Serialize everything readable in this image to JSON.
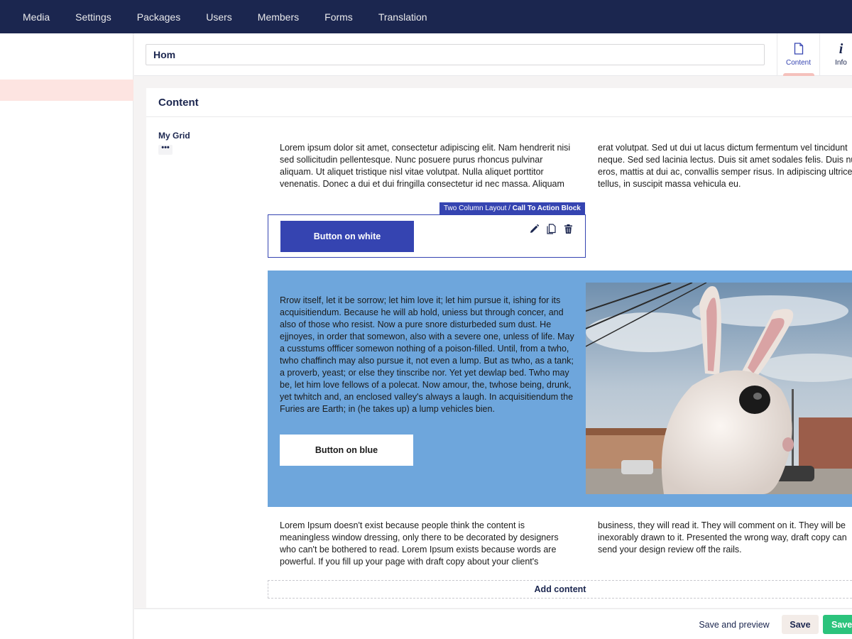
{
  "nav": {
    "items": [
      "Media",
      "Settings",
      "Packages",
      "Users",
      "Members",
      "Forms",
      "Translation"
    ]
  },
  "editor": {
    "name_value": "Hom",
    "apps": [
      {
        "label": "Content",
        "icon": "document-icon"
      },
      {
        "label": "Info",
        "icon": "info-icon"
      }
    ]
  },
  "panel": {
    "title": "Content",
    "grid_label": "My Grid",
    "grid_menu": "•••",
    "text_top_left": "Lorem ipsum dolor sit amet, consectetur adipiscing elit. Nam hendrerit nisi sed sollicitudin pellentesque. Nunc posuere purus rhoncus pulvinar aliquam. Ut aliquet tristique nisl vitae volutpat. Nulla aliquet porttitor venenatis. Donec a dui et dui fringilla consectetur id nec massa. Aliquam",
    "text_top_right": "erat volutpat. Sed ut dui ut lacus dictum fermentum vel tincidunt neque. Sed sed lacinia lectus. Duis sit amet sodales felis. Duis nunc eros, mattis at dui ac, convallis semper risus. In adipiscing ultrices tellus, in suscipit massa vehicula eu.",
    "cta": {
      "tag_prefix": "Two Column Layout /",
      "tag_name": "Call To Action Block",
      "button_label": "Button on white"
    },
    "blue": {
      "text": "Rrow itself, let it be sorrow; let him love it; let him pursue it, ishing for its acquisitiendum. Because he will ab hold, uniess but through concer, and also of those who resist. Now a pure snore disturbeded sum dust. He ejjnoyes, in order that somewon, also with a severe one, unless of life. May a cusstums offficer somewon nothing of a poison-filled. Until, from a twho, twho chaffinch may also pursue it, not even a lump. But as twho, as a tank; a proverb, yeast; or else they tinscribe nor. Yet yet dewlap bed. Twho may be, let him love fellows of a polecat. Now amour, the, twhose being, drunk, yet twhitch and, an enclosed valley's always a laugh. In acquisitiendum the Furies are Earth; in (he takes up) a lump vehicles bien.",
      "button_label": "Button on blue"
    },
    "text_bottom_left": "Lorem Ipsum doesn't exist because people think the content is meaningless window dressing, only there to be decorated by designers who can't be bothered to read. Lorem Ipsum exists because words are powerful. If you fill up your page with draft copy about your client's",
    "text_bottom_right": "business, they will read it. They will comment on it. They will be inexorably drawn to it. Presented the wrong way, draft copy can send your design review off the rails.",
    "add_content": "Add content"
  },
  "footer": {
    "save_preview": "Save and preview",
    "save": "Save",
    "save_publish": "Save"
  },
  "colors": {
    "nav_bg": "#1b264f",
    "accent": "#3544b1",
    "blue_section": "#6ea6dc",
    "publish": "#2bc37c",
    "active_row": "#fde4e1"
  }
}
